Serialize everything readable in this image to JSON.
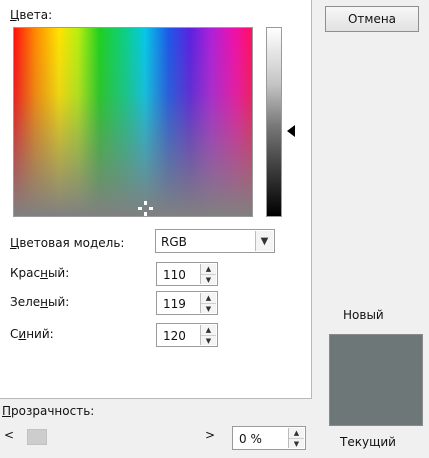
{
  "colors_label_underlined": "Ц",
  "colors_label_rest": "вета:",
  "color_model": {
    "label_underlined": "Ц",
    "label_rest": "ветовая модель:",
    "value": "RGB"
  },
  "channels": [
    {
      "label_before": "Крас",
      "label_underlined": "н",
      "label_after": "ый:",
      "value": "110"
    },
    {
      "label_before": "Зеле",
      "label_underlined": "н",
      "label_after": "ый:",
      "value": "119"
    },
    {
      "label_before": "С",
      "label_underlined": "и",
      "label_after": "ний:",
      "value": "120"
    }
  ],
  "cancel_button": "Отмена",
  "new_label": "Новый",
  "current_label": "Текущий",
  "transparency": {
    "label_underlined": "П",
    "label_rest": "розрачность:",
    "value": "0 %",
    "level_percent": 0
  },
  "preview_color": "#6e7778",
  "icons": {
    "dropdown": "▼",
    "spin_up": "▲",
    "spin_down": "▼",
    "scroll_left": "<",
    "scroll_right": ">",
    "luminance_pointer": "triangle-left"
  }
}
